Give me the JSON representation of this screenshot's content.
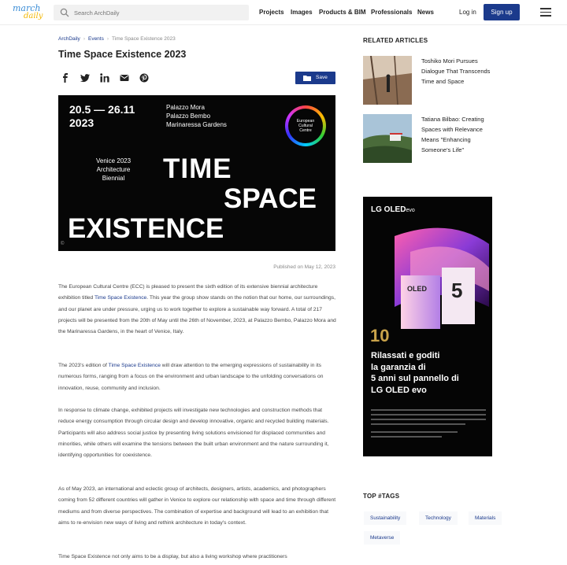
{
  "header": {
    "logo_top": "march",
    "logo_bottom": "daily",
    "search_placeholder": "Search ArchDaily",
    "nav": [
      "Projects",
      "Images",
      "Products & BIM",
      "Professionals",
      "News"
    ],
    "login": "Log in",
    "signup": "Sign up"
  },
  "article": {
    "breadcrumb": [
      "ArchDaily",
      "Events",
      "Time Space Existence 2023"
    ],
    "title": "Time Space Existence 2023",
    "save_label": "Save",
    "poster": {
      "dates": "20.5 — 26.11\n2023",
      "venues": "Palazzo Mora\nPalazzo Bembo\nMarinaressa Gardens",
      "ecc": "European\nCultural\nCentre",
      "biennial": "Venice 2023\nArchitecture\nBiennial",
      "word1": "TIME",
      "word2": "SPACE",
      "word3": "EXISTENCE",
      "corner": "©"
    },
    "published": "Published on May 12, 2023",
    "p1_a": "The European Cultural Centre (ECC) is pleased to present the sixth edition of its extensive biennial architecture exhibition titled ",
    "p1_link": "Time Space Existence",
    "p1_b": ". This year the group show stands on the notion that our home, our surroundings, and our planet are under pressure, urging us to work together to explore a sustainable way forward. A total of 217 projects will be presented from the 20th of May until the 26th of November, 2023, at Palazzo Bembo, Palazzo Mora and the Marinaressa Gardens, in the heart of Venice, Italy.",
    "p2_a": "The 2023's edition of ",
    "p2_link": "Time Space Existence",
    "p2_b": " will draw attention to the emerging expressions of sustainability in its numerous forms, ranging from a focus on the environment and urban landscape to the unfolding conversations on innovation, reuse, community and inclusion.",
    "p3": "In response to climate change, exhibited projects will investigate new technologies and construction methods that reduce energy consumption through circular design and develop innovative, organic and recycled building materials. Participants will also address social justice by presenting living solutions envisioned for displaced communities and minorities, while others will examine the tensions between the built urban environment and the nature surrounding it, identifying opportunities for coexistence.",
    "p4": "As of May 2023, an international and eclectic group of architects, designers, artists, academics, and photographers coming from 52 different countries will gather in Venice to explore our relationship with space and time through different mediums and from diverse perspectives. The combination of expertise and background will lead to an exhibition that aims to re-envision new ways of living and rethink architecture in today's context.",
    "p5": "Time Space Existence not only aims to be a display, but also a living workshop where practitioners"
  },
  "sidebar": {
    "related_heading": "RELATED ARTICLES",
    "related": [
      {
        "title": "Toshiko Mori Pursues Dialogue That Transcends Time and Space"
      },
      {
        "title": "Tatiana Bilbao: Creating Spaces with Relevance Means \"Enhancing Someone's Life\""
      }
    ],
    "ad": {
      "brand": "LG OLED",
      "brand_suffix": "evo",
      "years": "10",
      "headline": "Rilassati e goditi\nla garanzia di\n5 anni sul pannello di\nLG OLED evo"
    },
    "tags_heading": "TOP #TAGS",
    "tags": [
      "Sustainability",
      "Technology",
      "Materials",
      "Metaverse"
    ]
  },
  "colors": {
    "brand_blue": "#1b3a8c",
    "poster_bg": "#060606"
  }
}
